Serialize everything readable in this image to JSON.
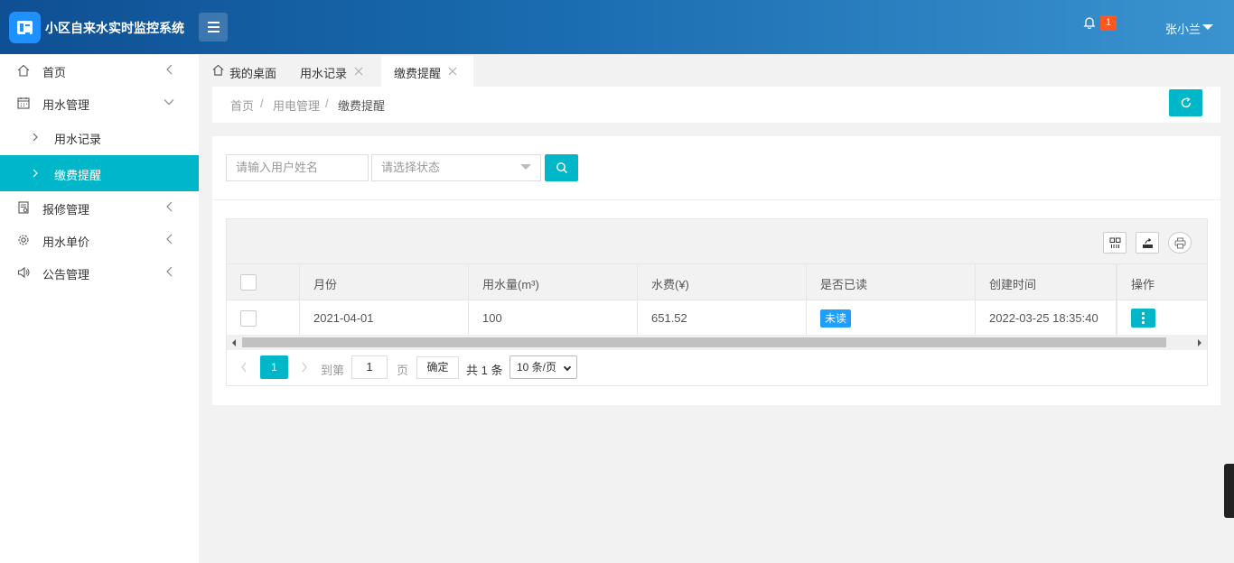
{
  "app": {
    "title": "小区自来水实时监控系统"
  },
  "header": {
    "notification_count": "1",
    "user_name": "张小兰"
  },
  "sidebar": {
    "items": [
      {
        "label": "首页",
        "icon": "home-icon"
      },
      {
        "label": "用水管理",
        "icon": "calendar-icon"
      },
      {
        "label": "报修管理",
        "icon": "file-icon"
      },
      {
        "label": "用水单价",
        "icon": "gear-icon"
      },
      {
        "label": "公告管理",
        "icon": "speaker-icon"
      }
    ],
    "subitems": [
      {
        "label": "用水记录"
      },
      {
        "label": "缴费提醒"
      }
    ]
  },
  "tabs": [
    {
      "label": "我的桌面"
    },
    {
      "label": "用水记录"
    },
    {
      "label": "缴费提醒"
    }
  ],
  "breadcrumb": {
    "items": [
      "首页",
      "用电管理",
      "缴费提醒"
    ],
    "separator": "/"
  },
  "search": {
    "name_placeholder": "请输入用户姓名",
    "status_placeholder": "请选择状态"
  },
  "table": {
    "columns": [
      "月份",
      "用水量(m³)",
      "水费(¥)",
      "是否已读",
      "创建时间",
      "操作"
    ],
    "rows": [
      {
        "month": "2021-04-01",
        "usage": "100",
        "fee": "651.52",
        "read_status": "未读",
        "created": "2022-03-25 18:35:40"
      }
    ]
  },
  "pager": {
    "current_page": "1",
    "goto_label": "到第",
    "goto_value": "1",
    "page_unit": "页",
    "confirm": "确定",
    "total": "共 1 条",
    "page_size": "10 条/页"
  },
  "colors": {
    "accent": "#00b7c9",
    "header_start": "#0f4f93",
    "header_end": "#3a93cf",
    "badge": "#ff5722",
    "unread": "#1e9fff"
  }
}
